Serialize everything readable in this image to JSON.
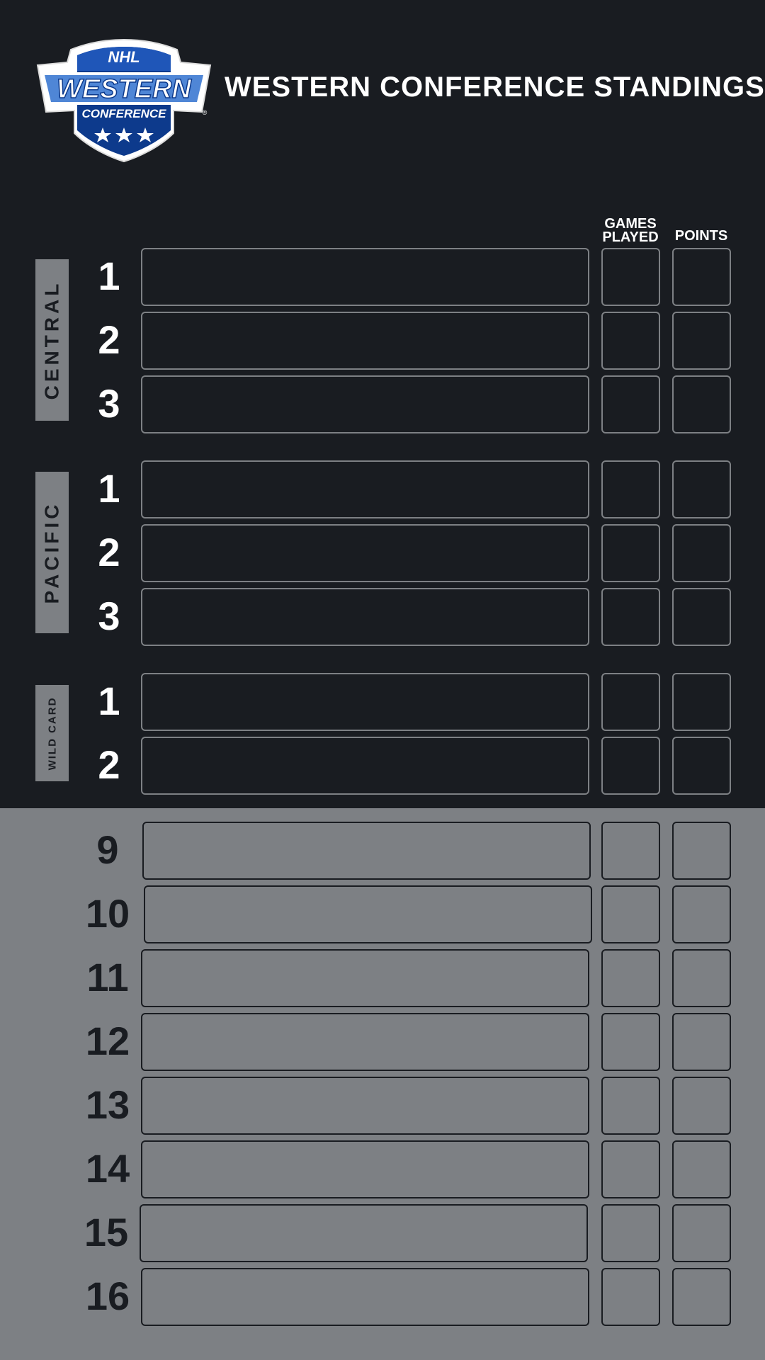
{
  "title": "WESTERN CONFERENCE STANDINGS",
  "logo": {
    "line1": "NHL",
    "line2": "WESTERN",
    "line3": "CONFERENCE",
    "mark": "®"
  },
  "headers": {
    "games_played_1": "GAMES",
    "games_played_2": "PLAYED",
    "points": "POINTS"
  },
  "divisions": [
    {
      "name": "CENTRAL",
      "ranks": [
        "1",
        "2",
        "3"
      ]
    },
    {
      "name": "PACIFIC",
      "ranks": [
        "1",
        "2",
        "3"
      ]
    },
    {
      "name": "WILD CARD",
      "ranks": [
        "1",
        "2"
      ]
    }
  ],
  "others": [
    "9",
    "10",
    "11",
    "12",
    "13",
    "14",
    "15",
    "16"
  ],
  "colors": {
    "background": "#191c21",
    "lower_panel": "#7d8084",
    "logo_blue": "#0d3a8c",
    "text": "#ffffff"
  }
}
